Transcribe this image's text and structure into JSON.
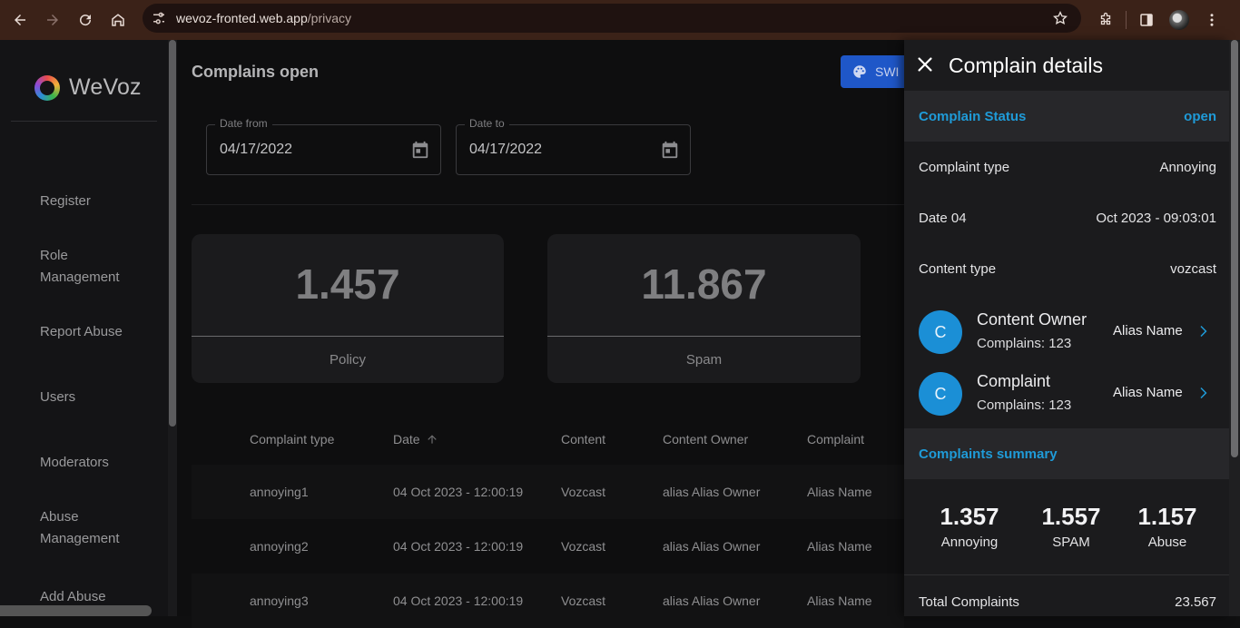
{
  "browser": {
    "url_host": "wevoz-fronted.web.app",
    "url_path": "/privacy"
  },
  "sidebar": {
    "brand": "WeVoz",
    "items": [
      {
        "label": "Register"
      },
      {
        "label": "Role\nManagement"
      },
      {
        "label": "Report Abuse"
      },
      {
        "label": "Users"
      },
      {
        "label": "Moderators"
      },
      {
        "label": "Abuse\nManagement"
      },
      {
        "label": "Add Abuse"
      }
    ]
  },
  "main": {
    "title": "Complains open",
    "switch_label": "SWI",
    "date_from": {
      "label": "Date from",
      "value": "04/17/2022"
    },
    "date_to": {
      "label": "Date to",
      "value": "04/17/2022"
    },
    "cards": [
      {
        "value": "1.457",
        "label": "Policy"
      },
      {
        "value": "11.867",
        "label": "Spam"
      }
    ],
    "table": {
      "columns": [
        "Complaint type",
        "Date",
        "Content",
        "Content Owner",
        "Complaint"
      ],
      "rows": [
        [
          "annoying1",
          "04 Oct 2023 - 12:00:19",
          "Vozcast",
          "alias Alias Owner",
          "Alias Name"
        ],
        [
          "annoying2",
          "04 Oct 2023 - 12:00:19",
          "Vozcast",
          "alias Alias Owner",
          "Alias Name"
        ],
        [
          "annoying3",
          "04 Oct 2023 - 12:00:19",
          "Vozcast",
          "alias Alias Owner",
          "Alias Name"
        ]
      ]
    }
  },
  "drawer": {
    "title": "Complain details",
    "status": {
      "label": "Complain Status",
      "value": "open"
    },
    "details": [
      {
        "key": "Complaint type",
        "value": "Annoying"
      },
      {
        "key": "Date 04",
        "value": "Oct 2023 - 09:03:01"
      },
      {
        "key": "Content type",
        "value": "vozcast"
      }
    ],
    "people": [
      {
        "initial": "C",
        "role": "Content Owner",
        "count": "Complains: 123",
        "alias": "Alias Name"
      },
      {
        "initial": "C",
        "role": "Complaint",
        "count": "Complains: 123",
        "alias": "Alias Name"
      }
    ],
    "summary_label": "Complaints summary",
    "summary": [
      {
        "value": "1.357",
        "label": "Annoying"
      },
      {
        "value": "1.557",
        "label": "SPAM"
      },
      {
        "value": "1.157",
        "label": "Abuse"
      }
    ],
    "total": {
      "label": "Total Complaints",
      "value": "23.567"
    }
  },
  "colors": {
    "accent": "#1f9bd8",
    "browser_bar": "#3b2218",
    "avatar": "#1b8fd6",
    "switch_button": "#1f57c8"
  }
}
